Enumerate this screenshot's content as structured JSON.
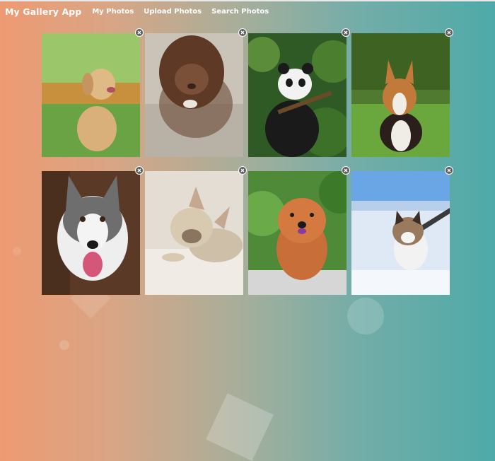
{
  "nav": {
    "brand": "My Gallery App",
    "links": [
      {
        "label": "My Photos"
      },
      {
        "label": "Upload Photos"
      },
      {
        "label": "Search Photos"
      }
    ]
  },
  "gallery": {
    "photos": [
      {
        "subject": "golden retriever puppy on grass with orange flowers"
      },
      {
        "subject": "brown curly poodle puppy on a rock"
      },
      {
        "subject": "giant panda in green tree"
      },
      {
        "subject": "corgi sitting on grass"
      },
      {
        "subject": "husky with tongue out"
      },
      {
        "subject": "french bulldog lying on white blanket"
      },
      {
        "subject": "chow chow dog with leaves"
      },
      {
        "subject": "tabby cat walking on snow"
      }
    ],
    "delete_icon": "close-icon"
  },
  "colors": {
    "gradient_left": "#ee9a72",
    "gradient_right": "#4eaaa8",
    "nav_text": "#ffffff",
    "close_button": "#5e5e5e"
  }
}
